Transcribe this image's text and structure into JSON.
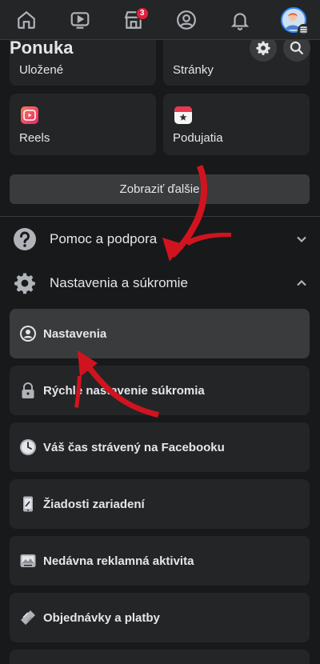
{
  "nav": {
    "tabs": [
      {
        "name": "home"
      },
      {
        "name": "watch"
      },
      {
        "name": "marketplace",
        "badge": "3"
      },
      {
        "name": "profile"
      },
      {
        "name": "notifications"
      },
      {
        "name": "menu"
      }
    ]
  },
  "header": {
    "title": "Ponuka"
  },
  "shortcuts": {
    "saved_label": "Uložené",
    "pages_label": "Stránky",
    "reels_label": "Reels",
    "events_label": "Podujatia"
  },
  "show_more_label": "Zobraziť ďalšie",
  "sections": {
    "help_label": "Pomoc a podpora",
    "settings_label": "Nastavenia a súkromie"
  },
  "settings_items": [
    {
      "label": "Nastavenia",
      "icon": "user-circle-icon"
    },
    {
      "label": "Rýchle nastavenie súkromia",
      "icon": "lock-icon"
    },
    {
      "label": "Váš čas strávený na Facebooku",
      "icon": "clock-icon"
    },
    {
      "label": "Žiadosti zariadení",
      "icon": "device-icon"
    },
    {
      "label": "Nedávna reklamná aktivita",
      "icon": "ad-activity-icon"
    },
    {
      "label": "Objednávky a platby",
      "icon": "payment-icon"
    }
  ],
  "colors": {
    "background": "#18191a",
    "surface": "#242526",
    "accent": "#2d88ff",
    "badge": "#e41e3f",
    "annotation_arrow": "#d0141f"
  }
}
